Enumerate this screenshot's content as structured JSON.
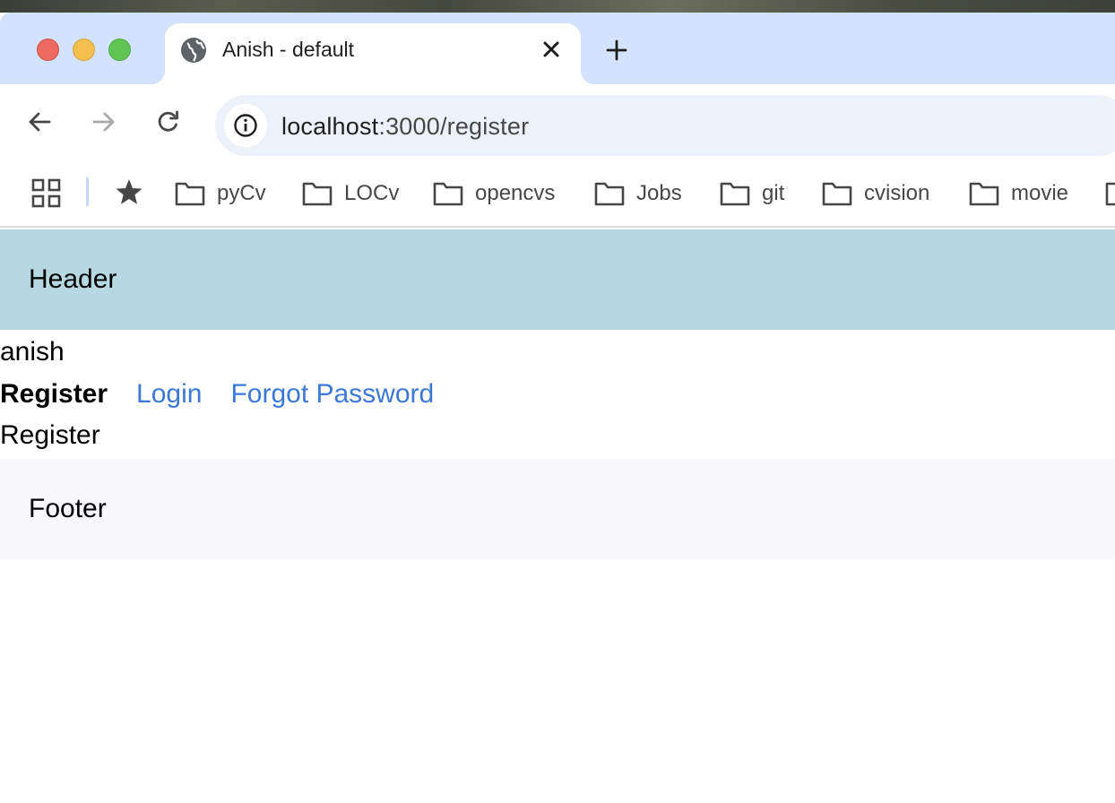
{
  "browser": {
    "tab": {
      "title": "Anish - default"
    },
    "address_bar": {
      "host": "localhost",
      "path": ":3000/register"
    },
    "bookmarks": [
      {
        "label": "pyCv"
      },
      {
        "label": "LOCv"
      },
      {
        "label": "opencvs"
      },
      {
        "label": "Jobs"
      },
      {
        "label": "git"
      },
      {
        "label": "cvision"
      },
      {
        "label": "movie"
      }
    ]
  },
  "page": {
    "header": {
      "label": "Header"
    },
    "username": "anish",
    "nav": {
      "active": "Register",
      "links": [
        "Login",
        "Forgot Password"
      ]
    },
    "content": "Register",
    "footer": {
      "label": "Footer"
    }
  },
  "colors": {
    "header_bg": "#b6d8e2",
    "footer_bg": "#f8f8fd",
    "link": "#3c78d8",
    "tabstrip_bg": "#d3e3fd"
  }
}
